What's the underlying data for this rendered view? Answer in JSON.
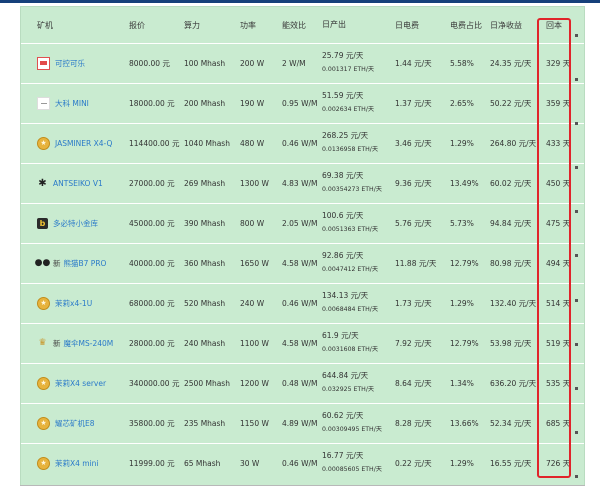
{
  "table": {
    "headers": {
      "name": "矿机",
      "price": "报价",
      "hashrate": "算力",
      "power": "功率",
      "efficiency": "能效比",
      "daily_output": "日产出",
      "daily_electricity": "日电费",
      "electricity_ratio": "电费占比",
      "daily_net": "日净收益",
      "payback": "回本"
    },
    "rows": [
      {
        "icon": "red-logo-icon",
        "prefix": "",
        "name": "可控可乐",
        "price": "8000.00 元",
        "hashrate": "100 Mhash",
        "power": "200 W",
        "efficiency": "2 W/M",
        "output_cny": "25.79 元/天",
        "output_eth": "0.001317 ETH/天",
        "electricity": "1.44 元/天",
        "ratio": "5.58%",
        "net": "24.35 元/天",
        "payback": "329 天"
      },
      {
        "icon": "plain-logo-icon",
        "prefix": "",
        "name": "大科 MINI",
        "price": "18000.00 元",
        "hashrate": "200 Mhash",
        "power": "190 W",
        "efficiency": "0.95 W/M",
        "output_cny": "51.59 元/天",
        "output_eth": "0.002634 ETH/天",
        "electricity": "1.37 元/天",
        "ratio": "2.65%",
        "net": "50.22 元/天",
        "payback": "359 天"
      },
      {
        "icon": "gold-coin-icon",
        "prefix": "",
        "name": "JASMINER X4-Q",
        "price": "114400.00 元",
        "hashrate": "1040 Mhash",
        "power": "480 W",
        "efficiency": "0.46 W/M",
        "output_cny": "268.25 元/天",
        "output_eth": "0.0136958 ETH/天",
        "electricity": "3.46 元/天",
        "ratio": "1.29%",
        "net": "264.80 元/天",
        "payback": "433 天"
      },
      {
        "icon": "bug-icon",
        "prefix": "",
        "name": "ANTSEIKO V1",
        "price": "27000.00 元",
        "hashrate": "269 Mhash",
        "power": "1300 W",
        "efficiency": "4.83 W/M",
        "output_cny": "69.38 元/天",
        "output_eth": "0.00354273 ETH/天",
        "electricity": "9.36 元/天",
        "ratio": "13.49%",
        "net": "60.02 元/天",
        "payback": "450 天"
      },
      {
        "icon": "dark-b-logo-icon",
        "prefix": "",
        "name": "多必特小金库",
        "price": "45000.00 元",
        "hashrate": "390 Mhash",
        "power": "800 W",
        "efficiency": "2.05 W/M",
        "output_cny": "100.6 元/天",
        "output_eth": "0.0051363 ETH/天",
        "electricity": "5.76 元/天",
        "ratio": "5.73%",
        "net": "94.84 元/天",
        "payback": "475 天"
      },
      {
        "icon": "panda-icon",
        "prefix": "新",
        "name": "熊猫B7 PRO",
        "price": "40000.00 元",
        "hashrate": "360 Mhash",
        "power": "1650 W",
        "efficiency": "4.58 W/M",
        "output_cny": "92.86 元/天",
        "output_eth": "0.0047412 ETH/天",
        "electricity": "11.88 元/天",
        "ratio": "12.79%",
        "net": "80.98 元/天",
        "payback": "494 天"
      },
      {
        "icon": "gold-coin-icon",
        "prefix": "",
        "name": "茉莉x4-1U",
        "price": "68000.00 元",
        "hashrate": "520 Mhash",
        "power": "240 W",
        "efficiency": "0.46 W/M",
        "output_cny": "134.13 元/天",
        "output_eth": "0.0068484 ETH/天",
        "electricity": "1.73 元/天",
        "ratio": "1.29%",
        "net": "132.40 元/天",
        "payback": "514 天"
      },
      {
        "icon": "trophy-icon",
        "prefix": "新",
        "name": "魔伞MS-240M",
        "price": "28000.00 元",
        "hashrate": "240 Mhash",
        "power": "1100 W",
        "efficiency": "4.58 W/M",
        "output_cny": "61.9 元/天",
        "output_eth": "0.0031608 ETH/天",
        "electricity": "7.92 元/天",
        "ratio": "12.79%",
        "net": "53.98 元/天",
        "payback": "519 天"
      },
      {
        "icon": "gold-coin-icon",
        "prefix": "",
        "name": "茉莉X4 server",
        "price": "340000.00 元",
        "hashrate": "2500 Mhash",
        "power": "1200 W",
        "efficiency": "0.48 W/M",
        "output_cny": "644.84 元/天",
        "output_eth": "0.032925 ETH/天",
        "electricity": "8.64 元/天",
        "ratio": "1.34%",
        "net": "636.20 元/天",
        "payback": "535 天"
      },
      {
        "icon": "gold-coin-icon",
        "prefix": "",
        "name": "耀芯矿机E8",
        "price": "35800.00 元",
        "hashrate": "235 Mhash",
        "power": "1150 W",
        "efficiency": "4.89 W/M",
        "output_cny": "60.62 元/天",
        "output_eth": "0.00309495 ETH/天",
        "electricity": "8.28 元/天",
        "ratio": "13.66%",
        "net": "52.34 元/天",
        "payback": "685 天"
      },
      {
        "icon": "gold-coin-icon",
        "prefix": "",
        "name": "茉莉X4 mini",
        "price": "11999.00 元",
        "hashrate": "65 Mhash",
        "power": "30 W",
        "efficiency": "0.46 W/M",
        "output_cny": "16.77 元/天",
        "output_eth": "0.00085605 ETH/天",
        "electricity": "0.22 元/天",
        "ratio": "1.29%",
        "net": "16.55 元/天",
        "payback": "726 天"
      }
    ]
  },
  "colors": {
    "panel_bg": "#c9ebd0",
    "link": "#2a7ac9",
    "highlight_border": "#e0242a",
    "top_rule": "#16407a"
  }
}
